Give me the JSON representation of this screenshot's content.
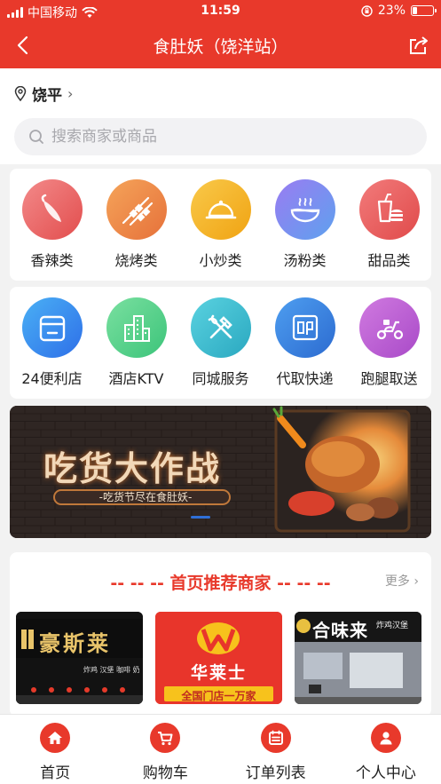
{
  "status_bar": {
    "carrier": "中国移动",
    "time": "11:59",
    "battery": "23%"
  },
  "nav": {
    "title": "食肚妖（饶洋站）"
  },
  "location": {
    "city": "饶平"
  },
  "search": {
    "placeholder": "搜索商家或商品"
  },
  "categories_food": [
    {
      "label": "香辣类",
      "icon": "chili-icon",
      "color": "#ef6a6a"
    },
    {
      "label": "烧烤类",
      "icon": "skewer-icon",
      "color": "#f08a4b"
    },
    {
      "label": "小炒类",
      "icon": "cloche-icon",
      "color": "#f5b21f"
    },
    {
      "label": "汤粉类",
      "icon": "soup-bowl-icon",
      "color": "#7a8cf0"
    },
    {
      "label": "甜品类",
      "icon": "drink-burger-icon",
      "color": "#ee6660"
    }
  ],
  "categories_service": [
    {
      "label": "24便利店",
      "icon": "store-icon",
      "color": "#3a8ff0"
    },
    {
      "label": "酒店KTV",
      "icon": "buildings-icon",
      "color": "#55d08a"
    },
    {
      "label": "同城服务",
      "icon": "tools-icon",
      "color": "#3ec0d0"
    },
    {
      "label": "代取快递",
      "icon": "mail-icon",
      "color": "#3a86d8"
    },
    {
      "label": "跑腿取送",
      "icon": "scooter-icon",
      "color": "#c05ad0"
    }
  ],
  "banner": {
    "headline": "吃货大作战",
    "subline": "-吃货节尽在食肚妖-"
  },
  "recommend": {
    "title": "-- -- -- 首页推荐商家 -- -- --",
    "more": "更多",
    "shops": [
      {
        "name": "豪斯莱",
        "tags": "炸鸡  汉堡  咖啡  奶"
      },
      {
        "name": "华莱士",
        "slogan": "全国门店一万家"
      },
      {
        "name": "合味来",
        "tags": "炸鸡汉堡"
      }
    ]
  },
  "tabs": [
    {
      "label": "首页",
      "icon": "home-icon"
    },
    {
      "label": "购物车",
      "icon": "cart-icon"
    },
    {
      "label": "订单列表",
      "icon": "order-list-icon"
    },
    {
      "label": "个人中心",
      "icon": "user-icon"
    }
  ]
}
